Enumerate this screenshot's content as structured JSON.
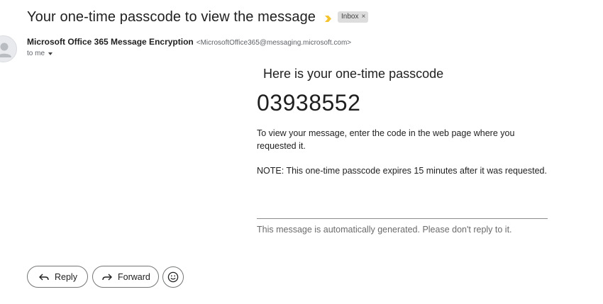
{
  "email": {
    "subject": "Your one-time passcode to view the message",
    "label": "Inbox",
    "label_remove": "×",
    "sender": {
      "name": "Microsoft Office 365 Message Encryption",
      "address": "<MicrosoftOffice365@messaging.microsoft.com>"
    },
    "recipient": "to me"
  },
  "body": {
    "heading": "Here is your one-time passcode",
    "passcode": "03938552",
    "instruction": "To view your message, enter the code in the web page where you requested it.",
    "note": "NOTE: This one-time passcode expires 15 minutes after it was requested.",
    "footer": "This message is automatically generated. Please don't reply to it."
  },
  "actions": {
    "reply_label": "Reply",
    "forward_label": "Forward"
  },
  "icons": {
    "important_marker": "important-marker-icon",
    "avatar": "person-avatar-icon",
    "recipient_caret": "chevron-down-icon",
    "reply": "reply-arrow-icon",
    "forward": "forward-arrow-icon",
    "emoji": "smiley-emoji-icon"
  },
  "colors": {
    "important_marker": "#f4c430",
    "label_chip_bg": "#dddddd",
    "divider": "#8c8c8c"
  }
}
